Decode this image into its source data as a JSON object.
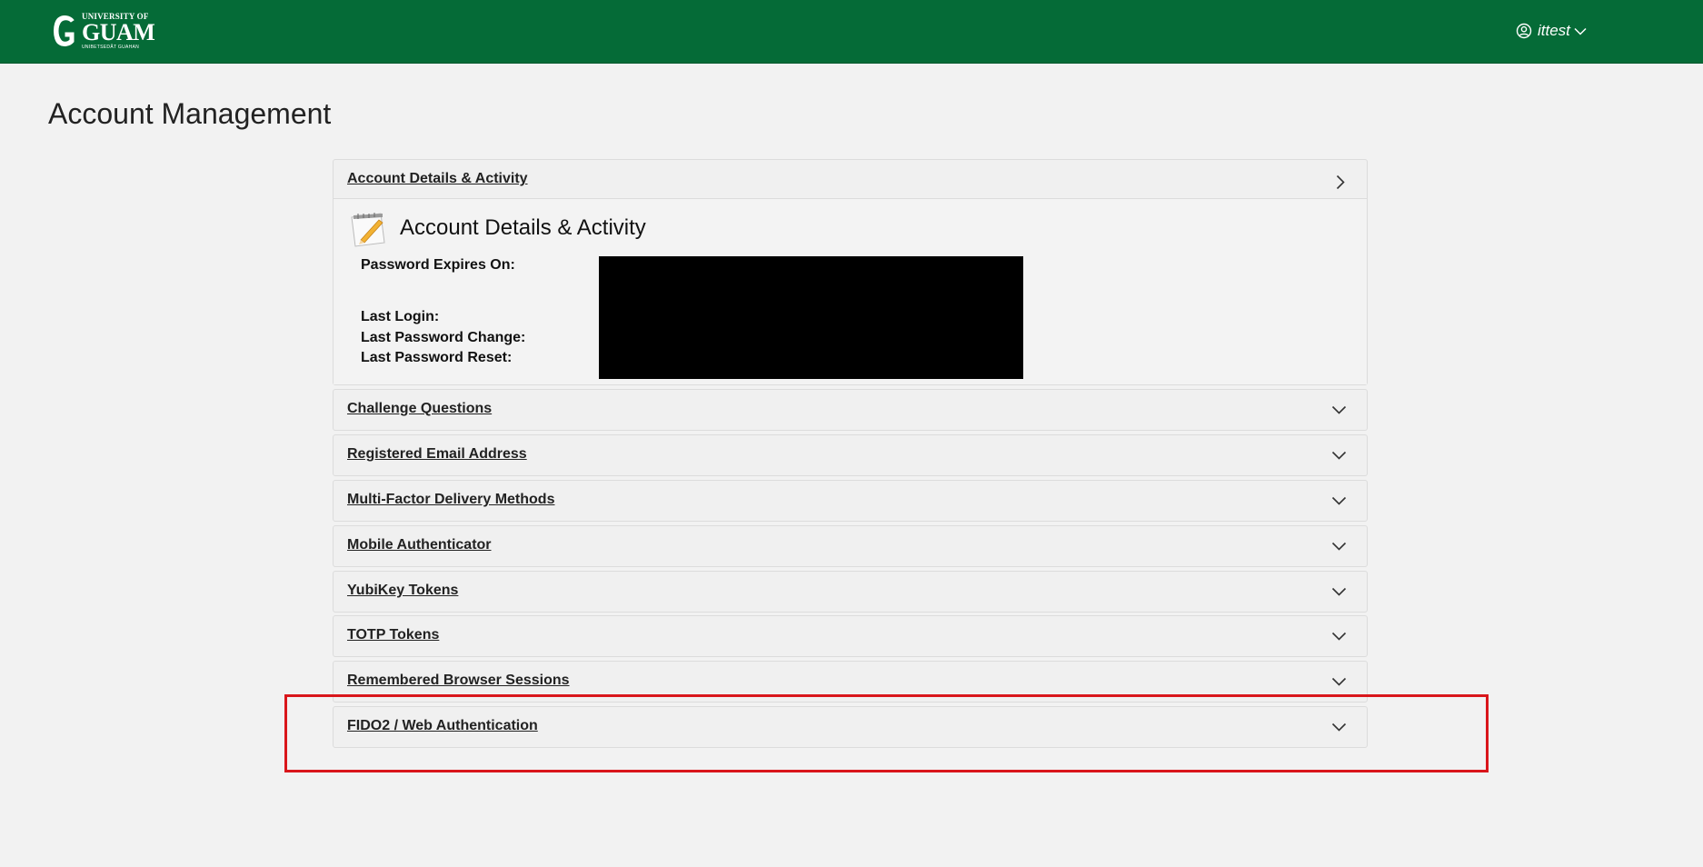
{
  "header": {
    "logo": {
      "line1": "UNIVERSITY OF",
      "line2": "GUAM",
      "line3": "UNIBETSEDÅT GUAHAN"
    },
    "user": {
      "name": "ittest",
      "icon": "user-circle-icon",
      "dropdown_icon": "chevron-down-icon"
    },
    "colors": {
      "brand_green": "#056b37",
      "highlight_red": "#d9161b"
    }
  },
  "page": {
    "title": "Account Management"
  },
  "account_details": {
    "header_label": "Account Details & Activity",
    "heading": "Account Details & Activity",
    "icon": "notepad-pencil-icon",
    "fields": [
      {
        "label": "Password Expires On:"
      },
      {
        "label": "Last Login:"
      },
      {
        "label": "Last Password Change:"
      },
      {
        "label": "Last Password Reset:"
      }
    ]
  },
  "sections": [
    {
      "label": "Challenge Questions"
    },
    {
      "label": "Registered Email Address"
    },
    {
      "label": "Multi-Factor Delivery Methods"
    },
    {
      "label": "Mobile Authenticator"
    },
    {
      "label": "YubiKey Tokens"
    },
    {
      "label": "TOTP Tokens"
    },
    {
      "label": "Remembered Browser Sessions"
    },
    {
      "label": "FIDO2 / Web Authentication"
    }
  ]
}
